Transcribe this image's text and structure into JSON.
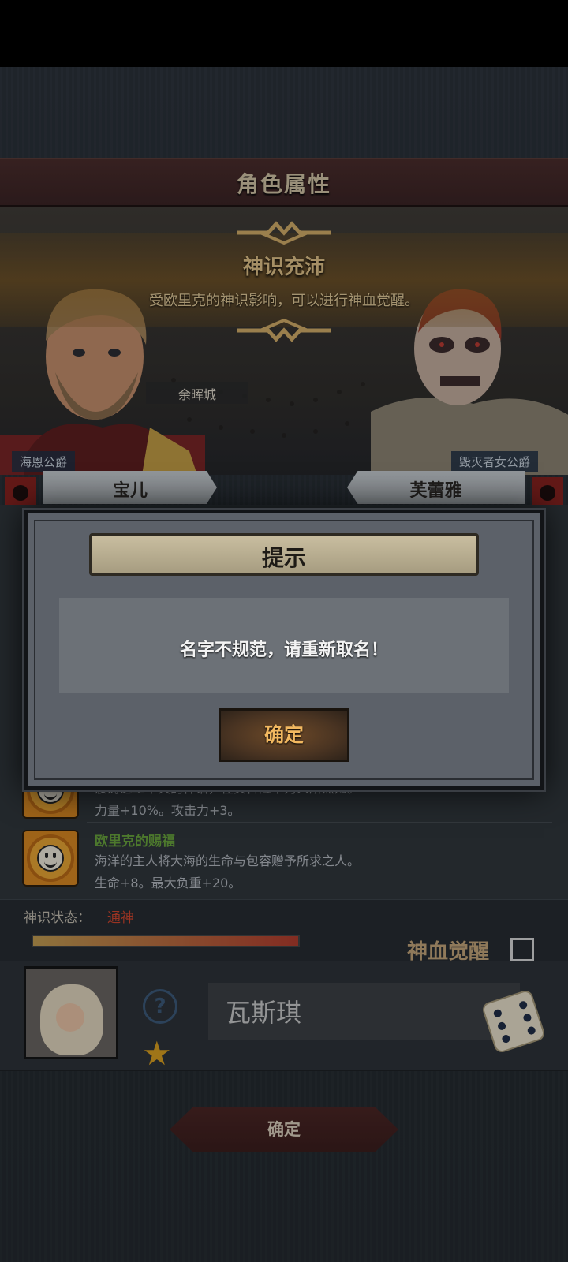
{
  "header": {
    "title": "角色属性"
  },
  "awakening_banner": {
    "title": "神识充沛",
    "description": "受欧里克的神识影响，可以进行神血觉醒。"
  },
  "map": {
    "city_label": "余晖城"
  },
  "parents": {
    "left": {
      "title": "海恩公爵",
      "name": "宝儿"
    },
    "right": {
      "title": "毁灭者女公爵",
      "name": "芙蕾雅"
    }
  },
  "traits": [
    {
      "name": "",
      "description": "波涛之主不灭的神话，在其冒险中为人所熟知。",
      "effect": "力量+10%。攻击力+3。"
    },
    {
      "name": "欧里克的赐福",
      "description": "海洋的主人将大海的生命与包容赠予所求之人。",
      "effect": "生命+8。最大负重+20。"
    }
  ],
  "status": {
    "label": "神识状态：",
    "value": "通神",
    "progress": 1.0,
    "value_color": "#d8442a"
  },
  "bloodline": {
    "label": "神血觉醒",
    "checked": false
  },
  "child": {
    "name_value": "瓦斯琪",
    "help_icon": "question-icon",
    "star_icon": "star-icon",
    "dice_icon": "dice-icon"
  },
  "bottom": {
    "confirm_label": "确定"
  },
  "dialog": {
    "title": "提示",
    "message": "名字不规范，请重新取名！",
    "ok_label": "确定"
  }
}
